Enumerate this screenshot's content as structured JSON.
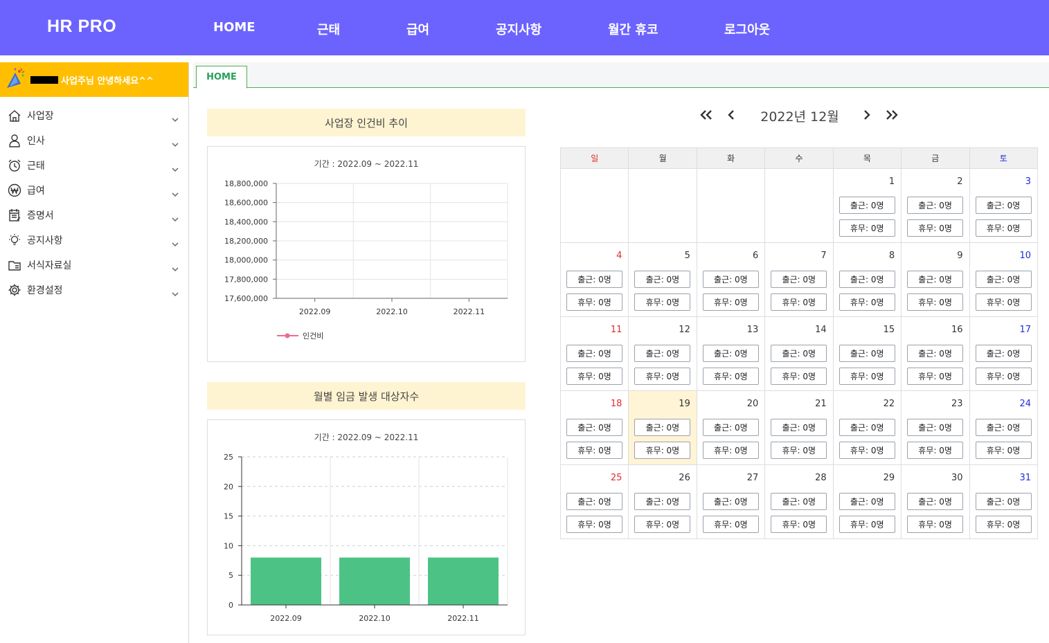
{
  "brand": "HR PRO",
  "topnav": [
    "HOME",
    "근태",
    "급여",
    "공지사항",
    "월간 휴코",
    "로그아웃"
  ],
  "greeting": "사업주님 안녕하세요^^",
  "sidebar": [
    {
      "label": "사업장",
      "icon": "home-icon"
    },
    {
      "label": "인사",
      "icon": "person-icon"
    },
    {
      "label": "근태",
      "icon": "alarm-clock-icon"
    },
    {
      "label": "급여",
      "icon": "won-coin-icon"
    },
    {
      "label": "증명서",
      "icon": "certificate-icon"
    },
    {
      "label": "공지사항",
      "icon": "lightbulb-icon"
    },
    {
      "label": "서식자료실",
      "icon": "folder-icon"
    },
    {
      "label": "환경설정",
      "icon": "gear-icon"
    }
  ],
  "tab": "HOME",
  "panels": {
    "cost_title": "사업장 인건비 추이",
    "count_title": "월별 임금 발생 대상자수"
  },
  "colors": {
    "header": "#6c63ff",
    "greeting": "#ffbf00",
    "line": "#f06a87",
    "bar": "#4cc385"
  },
  "chart_data": [
    {
      "type": "line",
      "title": "기간 : 2022.09 ~ 2022.11",
      "categories": [
        "2022.09",
        "2022.10",
        "2022.11"
      ],
      "series": [
        {
          "name": "인건비",
          "values": []
        }
      ],
      "ylim": [
        17600000,
        18800000
      ],
      "yticks": [
        "18,800,000",
        "18,600,000",
        "18,400,000",
        "18,200,000",
        "18,000,000",
        "17,800,000",
        "17,600,000"
      ],
      "grid": true,
      "legend": "bottom-left"
    },
    {
      "type": "bar",
      "title": "기간 : 2022.09 ~ 2022.11",
      "categories": [
        "2022.09",
        "2022.10",
        "2022.11"
      ],
      "values": [
        8,
        8,
        8
      ],
      "ylim": [
        0,
        25
      ],
      "yticks": [
        "25",
        "20",
        "15",
        "10",
        "5",
        "0"
      ],
      "grid": true
    }
  ],
  "calendar": {
    "title": "2022년 12월",
    "weekdays": [
      "일",
      "월",
      "화",
      "수",
      "목",
      "금",
      "토"
    ],
    "today": 19,
    "first_weekday": 4,
    "days_in_month": 31,
    "attend_label": "출근: 0명",
    "rest_label": "휴무: 0명"
  }
}
